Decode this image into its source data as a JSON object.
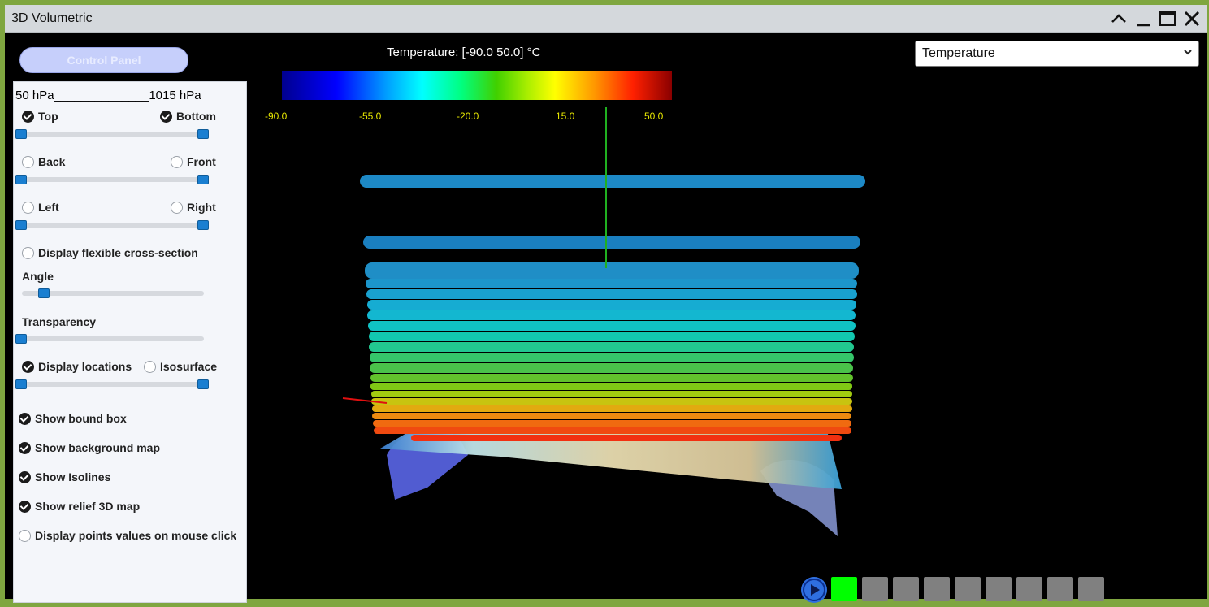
{
  "window": {
    "title": "3D Volumetric"
  },
  "control_panel": {
    "button_label": "Control Panel",
    "pressure_range": "50 hPa______________1015 hPa",
    "top_label": "Top",
    "bottom_label": "Bottom",
    "back_label": "Back",
    "front_label": "Front",
    "left_label": "Left",
    "right_label": "Right",
    "flex_label": "Display flexible cross-section",
    "angle_label": "Angle",
    "transparency_label": "Transparency",
    "locations_label": "Display locations",
    "isosurface_label": "Isosurface",
    "bound_box_label": "Show bound box",
    "bg_map_label": "Show background map",
    "isolines_label": "Show Isolines",
    "relief_label": "Show relief 3D map",
    "points_label": "Display points values on mouse click",
    "checked": {
      "top": true,
      "bottom": true,
      "back": false,
      "front": false,
      "left": false,
      "right": false,
      "flex": false,
      "locations": true,
      "isosurface": false,
      "bound_box": true,
      "bg_map": true,
      "isolines": true,
      "relief": true,
      "points": false
    }
  },
  "variable_select": {
    "value": "Temperature"
  },
  "colorbar": {
    "title": "Temperature: [-90.0 50.0] °C",
    "ticks": [
      "-90.0",
      "-55.0",
      "-20.0",
      "15.0",
      "50.0"
    ],
    "tick_color": "#e6e600"
  },
  "playback": {
    "steps": 9,
    "current_step": 1,
    "active_color": "#00ff00",
    "idle_color": "#808080"
  }
}
